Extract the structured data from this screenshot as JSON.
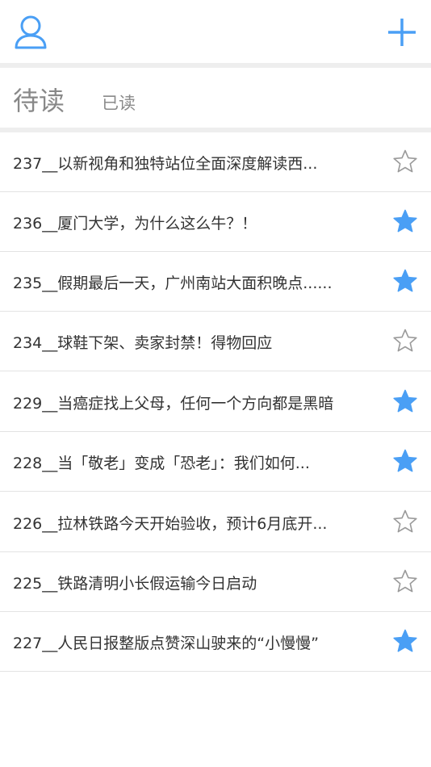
{
  "header": {
    "user_icon": "user-icon",
    "add_icon": "plus-icon"
  },
  "tabs": {
    "unread_label": "待读",
    "read_label": "已读"
  },
  "colors": {
    "accent": "#4a9ff5",
    "star_outline": "#9a9a9a"
  },
  "items": [
    {
      "title": "237__以新视角和独特站位全面深度解读西...",
      "starred": false
    },
    {
      "title": "236__厦门大学，为什么这么牛？！",
      "starred": true
    },
    {
      "title": "235__假期最后一天，广州南站大面积晚点......",
      "starred": true
    },
    {
      "title": "234__球鞋下架、卖家封禁！得物回应",
      "starred": false
    },
    {
      "title": "229__当癌症找上父母，任何一个方向都是黑暗",
      "starred": true
    },
    {
      "title": "228__当「敬老」变成「恐老」：我们如何...",
      "starred": true
    },
    {
      "title": "226__拉林铁路今天开始验收，预计6月底开...",
      "starred": false
    },
    {
      "title": "225__铁路清明小长假运输今日启动",
      "starred": false
    },
    {
      "title": "227__人民日报整版点赞深山驶来的“小慢慢”",
      "starred": true
    }
  ]
}
